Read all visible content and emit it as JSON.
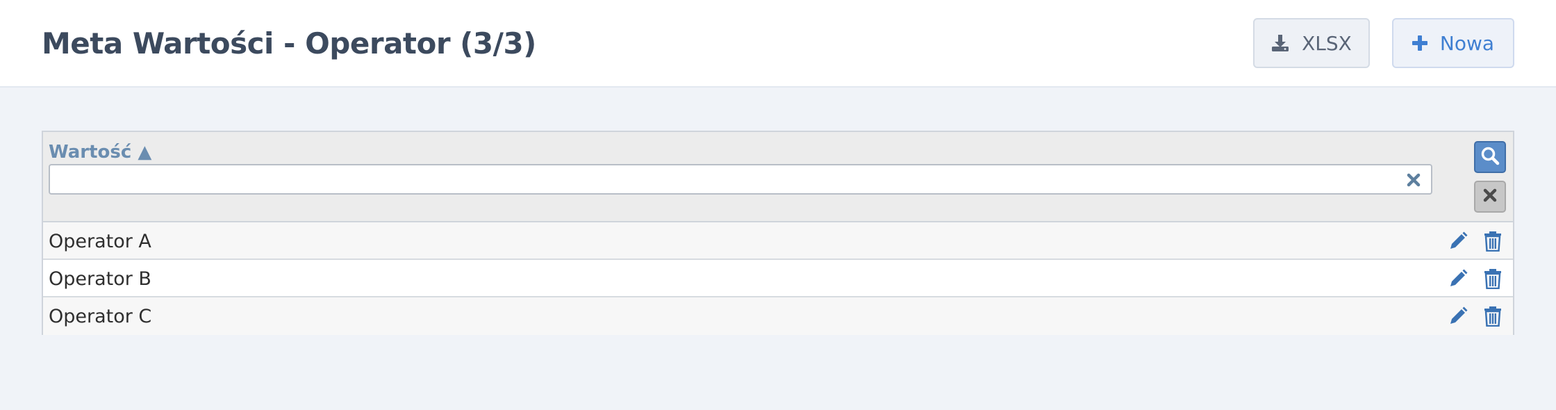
{
  "header": {
    "title": "Meta Wartości - Operator (3/3)",
    "export_label": "XLSX",
    "new_label": "Nowa"
  },
  "grid": {
    "column": {
      "title": "Wartość ▲",
      "filter_value": "",
      "filter_placeholder": ""
    },
    "rows": [
      {
        "value": "Operator A"
      },
      {
        "value": "Operator B"
      },
      {
        "value": "Operator C"
      }
    ]
  },
  "icons": {
    "export": "download-icon",
    "new": "plus-icon",
    "search": "search-icon",
    "reset": "close-icon",
    "filter_clear": "close-icon",
    "edit": "pencil-icon",
    "delete": "trash-icon"
  },
  "colors": {
    "accent": "#3f7fd2",
    "action_icon": "#3a72b3",
    "search_button": "#5b8dc9",
    "header_bg": "#ffffff",
    "page_bg": "#f0f3f8"
  }
}
